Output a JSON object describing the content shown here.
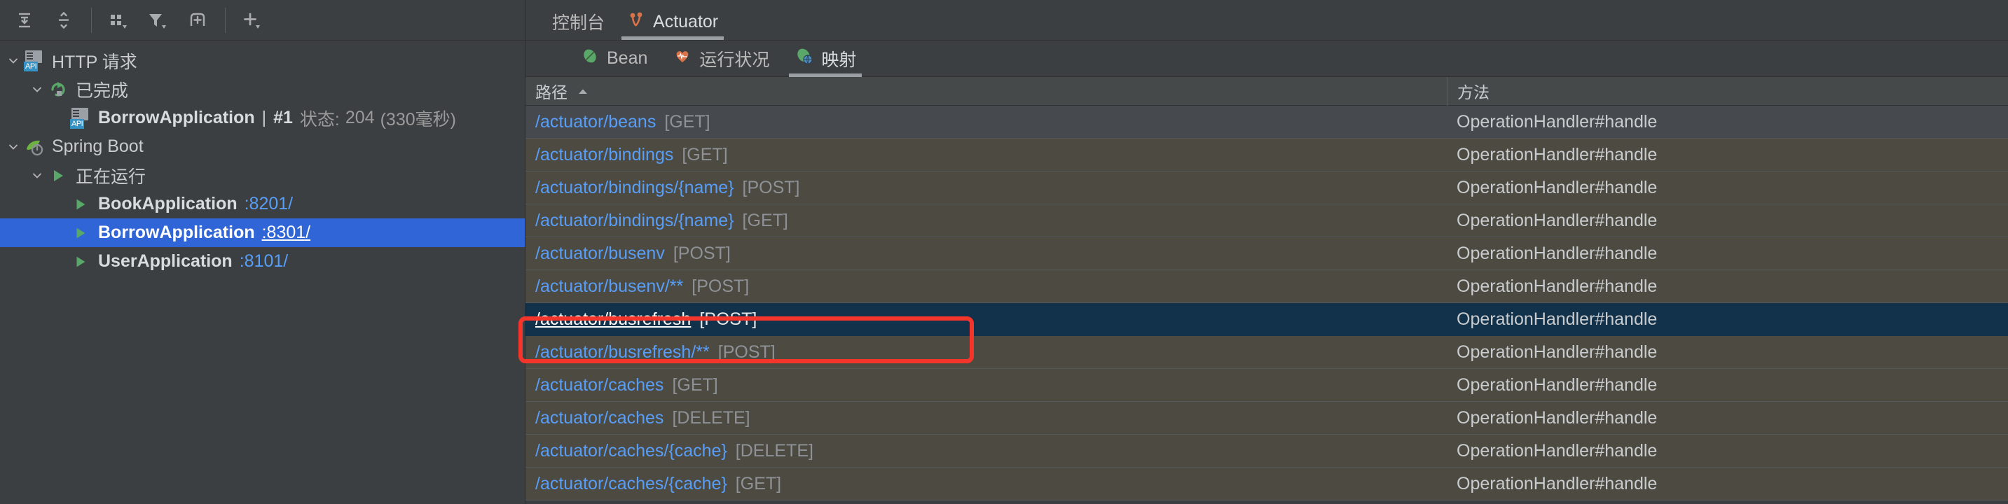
{
  "left_panel": {
    "toolbar": {
      "buttons": [
        {
          "name": "expand-all-icon",
          "label": "展开全部"
        },
        {
          "name": "collapse-all-icon",
          "label": "折叠全部"
        },
        {
          "name": "group-by-icon",
          "label": "分组依据"
        },
        {
          "name": "filter-icon",
          "label": "筛选"
        },
        {
          "name": "add-frame-icon",
          "label": "新建标签页"
        },
        {
          "name": "add-icon",
          "label": "添加"
        }
      ]
    },
    "tree": {
      "http_request": {
        "label": "HTTP 请求",
        "icon": "api-document-icon",
        "expanded": true,
        "completed": {
          "label": "已完成",
          "icon": "rerun-green-icon",
          "expanded": true,
          "item": {
            "name": "BorrowApplication",
            "separator": "|",
            "request_no": "#1",
            "status_label": "状态:",
            "status_code": "204",
            "duration": "(330毫秒)"
          }
        }
      },
      "spring_boot": {
        "label": "Spring Boot",
        "icon": "spring-leaf-icon",
        "expanded": true,
        "running": {
          "label": "正在运行",
          "icon": "run-green-icon",
          "expanded": true,
          "apps": [
            {
              "name": "BookApplication",
              "port": ":8201/",
              "selected": false
            },
            {
              "name": "BorrowApplication",
              "port": ":8301/",
              "selected": true
            },
            {
              "name": "UserApplication",
              "port": ":8101/",
              "selected": false
            }
          ]
        }
      }
    }
  },
  "right_panel": {
    "tabs": [
      {
        "label": "控制台",
        "icon": null,
        "active": false
      },
      {
        "label": "Actuator",
        "icon": "actuator-icon",
        "active": true
      }
    ],
    "subtabs": [
      {
        "label": "Bean",
        "icon": "bean-icon",
        "active": false
      },
      {
        "label": "运行状况",
        "icon": "health-heart-icon",
        "active": false
      },
      {
        "label": "映射",
        "icon": "mappings-icon",
        "active": true
      }
    ],
    "table": {
      "columns": [
        {
          "label": "路径",
          "sorted": "asc",
          "sort_caret": "▲"
        },
        {
          "label": "方法",
          "sorted": null
        }
      ],
      "rows": [
        {
          "path": "/actuator/beans",
          "verb": "[GET]",
          "method": "OperationHandler#handle",
          "tint": "grey",
          "selected": false
        },
        {
          "path": "/actuator/bindings",
          "verb": "[GET]",
          "method": "OperationHandler#handle",
          "tint": "olive",
          "selected": false
        },
        {
          "path": "/actuator/bindings/{name}",
          "verb": "[POST]",
          "method": "OperationHandler#handle",
          "tint": "olive",
          "selected": false
        },
        {
          "path": "/actuator/bindings/{name}",
          "verb": "[GET]",
          "method": "OperationHandler#handle",
          "tint": "olive",
          "selected": false
        },
        {
          "path": "/actuator/busenv",
          "verb": "[POST]",
          "method": "OperationHandler#handle",
          "tint": "olive",
          "selected": false
        },
        {
          "path": "/actuator/busenv/**",
          "verb": "[POST]",
          "method": "OperationHandler#handle",
          "tint": "olive",
          "selected": false
        },
        {
          "path": "/actuator/busrefresh",
          "verb": "[POST]",
          "method": "OperationHandler#handle",
          "tint": "selected",
          "selected": true
        },
        {
          "path": "/actuator/busrefresh/**",
          "verb": "[POST]",
          "method": "OperationHandler#handle",
          "tint": "olive",
          "selected": false
        },
        {
          "path": "/actuator/caches",
          "verb": "[GET]",
          "method": "OperationHandler#handle",
          "tint": "olive",
          "selected": false
        },
        {
          "path": "/actuator/caches",
          "verb": "[DELETE]",
          "method": "OperationHandler#handle",
          "tint": "olive",
          "selected": false
        },
        {
          "path": "/actuator/caches/{cache}",
          "verb": "[DELETE]",
          "method": "OperationHandler#handle",
          "tint": "olive",
          "selected": false
        },
        {
          "path": "/actuator/caches/{cache}",
          "verb": "[GET]",
          "method": "OperationHandler#handle",
          "tint": "olive",
          "selected": false
        }
      ]
    }
  },
  "annotation": {
    "shape": "rectangle",
    "color": "#F4352B",
    "targets_row": "/actuator/busrefresh [POST]"
  },
  "colors": {
    "background": "#3C3F41",
    "selection_blue": "#2F65D6",
    "row_selected": "#12314A",
    "row_grey": "#464A4F",
    "row_olive": "#4D4A42",
    "link_blue": "#589DF6",
    "annotation_red": "#F4352B",
    "green": "#59A869",
    "orange": "#D9734A"
  }
}
